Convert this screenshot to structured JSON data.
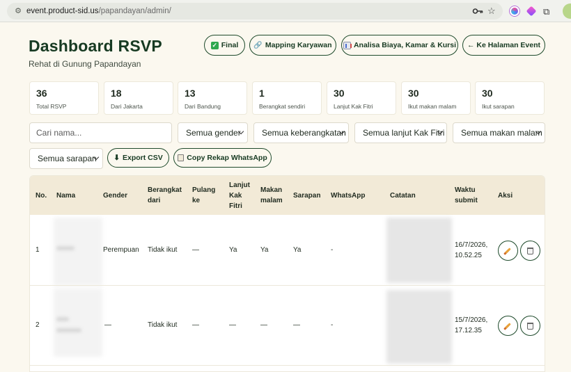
{
  "browser": {
    "url_host": "event.product-sid.us",
    "url_path": "/papandayan/admin/"
  },
  "header": {
    "title": "Dashboard RSVP",
    "subtitle": "Rehat di Gunung Papandayan",
    "buttons": {
      "final": "Final",
      "mapping": "Mapping Karyawan",
      "analisa": "Analisa Biaya, Kamar & Kursi",
      "event": "← Ke Halaman Event"
    }
  },
  "stats": [
    {
      "value": "36",
      "label": "Total RSVP"
    },
    {
      "value": "18",
      "label": "Dari Jakarta"
    },
    {
      "value": "13",
      "label": "Dari Bandung"
    },
    {
      "value": "1",
      "label": "Berangkat sendiri"
    },
    {
      "value": "30",
      "label": "Lanjut Kak Fitri"
    },
    {
      "value": "30",
      "label": "Ikut makan malam"
    },
    {
      "value": "30",
      "label": "Ikut sarapan"
    }
  ],
  "filters": {
    "search_placeholder": "Cari nama...",
    "gender": "Semua gender",
    "berangkat": "Semua keberangkatan",
    "kakfitri": "Semua lanjut Kak Fitri",
    "makan": "Semua makan malam",
    "sarapan": "Semua sarapan"
  },
  "actions": {
    "export": "Export CSV",
    "whatsapp": "Copy Rekap WhatsApp"
  },
  "table": {
    "headers": {
      "no": "No.",
      "nama": "Nama",
      "gender": "Gender",
      "berangkat": "Berangkat dari",
      "pulang": "Pulang ke",
      "kakfitri": "Lanjut Kak Fitri",
      "makan": "Makan malam",
      "sarapan": "Sarapan",
      "whatsapp": "WhatsApp",
      "catatan": "Catatan",
      "waktu": "Waktu submit",
      "aksi": "Aksi"
    },
    "rows": [
      {
        "no": "1",
        "gender": "Perempuan",
        "berangkat": "Tidak ikut",
        "pulang": "—",
        "kakfitri": "Ya",
        "makan": "Ya",
        "sarapan": "Ya",
        "whatsapp": "-",
        "waktu_date": "16/7/2026,",
        "waktu_time": "10.52.25"
      },
      {
        "no": "2",
        "gender": "—",
        "berangkat": "Tidak ikut",
        "pulang": "—",
        "kakfitri": "—",
        "makan": "—",
        "sarapan": "—",
        "whatsapp": "-",
        "waktu_date": "15/7/2026,",
        "waktu_time": "17.12.35"
      }
    ]
  }
}
